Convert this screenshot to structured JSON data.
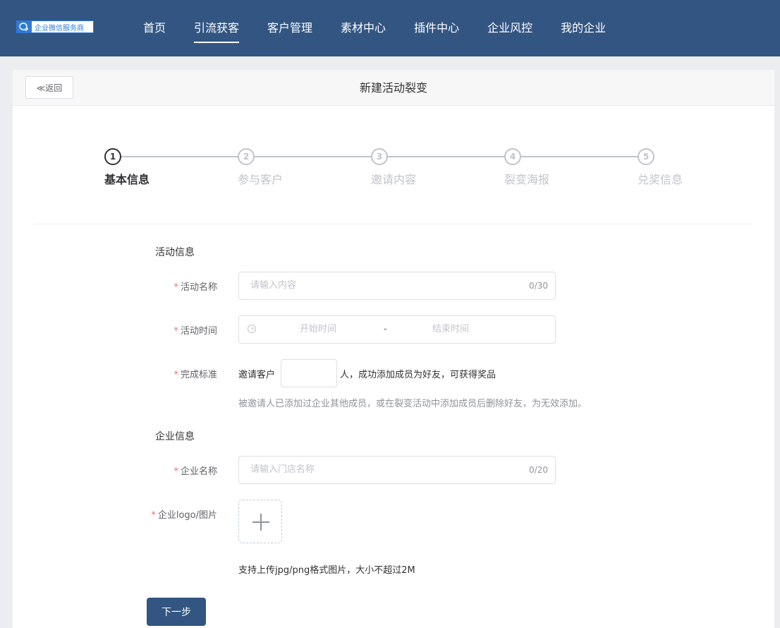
{
  "logo": {
    "text": "企业微信服务商"
  },
  "nav": {
    "items": [
      {
        "label": "首页"
      },
      {
        "label": "引流获客"
      },
      {
        "label": "客户管理"
      },
      {
        "label": "素材中心"
      },
      {
        "label": "插件中心"
      },
      {
        "label": "企业风控"
      },
      {
        "label": "我的企业"
      }
    ],
    "active_index": 1
  },
  "page": {
    "back_label": "≪返回",
    "title": "新建活动裂变"
  },
  "steps": [
    {
      "num": "1",
      "label": "基本信息"
    },
    {
      "num": "2",
      "label": "参与客户"
    },
    {
      "num": "3",
      "label": "邀请内容"
    },
    {
      "num": "4",
      "label": "裂变海报"
    },
    {
      "num": "5",
      "label": "兑奖信息"
    }
  ],
  "form": {
    "section_activity": "活动信息",
    "activity_name": {
      "label": "活动名称",
      "placeholder": "请输入内容",
      "count": "0/30"
    },
    "activity_time": {
      "label": "活动时间",
      "start": "开始时间",
      "sep": "-",
      "end": "结束时间"
    },
    "criteria": {
      "label": "完成标准",
      "prefix": "邀请客户",
      "suffix": "人，成功添加成员为好友，可获得奖品",
      "hint": "被邀请人已添加过企业其他成员，或在裂变活动中添加成员后删除好友，为无效添加。"
    },
    "section_company": "企业信息",
    "company_name": {
      "label": "企业名称",
      "placeholder": "请输入门店名称",
      "count": "0/20"
    },
    "company_logo": {
      "label": "企业logo/图片",
      "hint": "支持上传jpg/png格式图片，大小不超过2M"
    },
    "next_label": "下一步"
  },
  "colors": {
    "primary": "#325582",
    "required": "#f56c6c",
    "placeholder": "#c0c4cc"
  }
}
